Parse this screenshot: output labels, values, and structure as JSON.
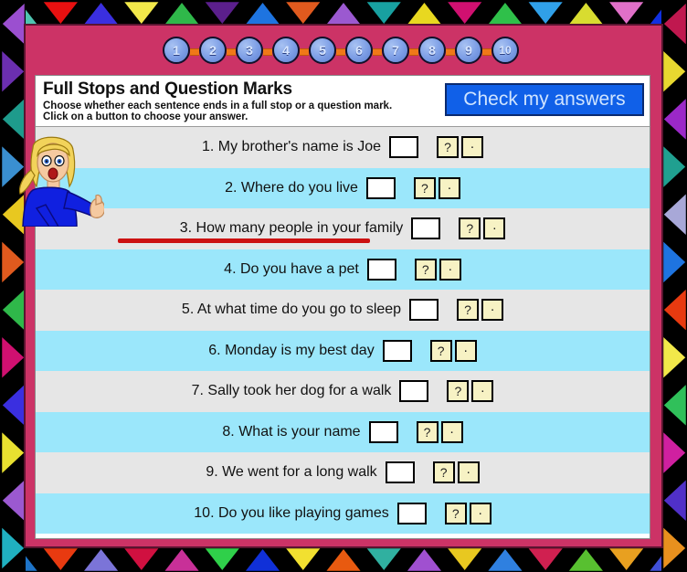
{
  "page": {
    "title": "Full Stops and Question Marks",
    "instruction_line1": "Choose whether each sentence ends in a full stop or a question mark.",
    "instruction_line2": "Click on a button to choose your answer.",
    "check_button_label": "Check my answers",
    "question_mark_label": "?",
    "full_stop_label": "."
  },
  "colors": {
    "frame_pink": "#CC3366",
    "check_button_blue": "#1060E8",
    "check_button_text": "#CFE4FF",
    "row_odd": "#E6E6E6",
    "row_even": "#9BE7FB",
    "answer_button_yellow": "#F7F2C4",
    "underline_red": "#CC1111",
    "node_blue": "#7E9FE6",
    "chain_orange": "#F07818"
  },
  "nav": {
    "nodes": [
      {
        "label": "1"
      },
      {
        "label": "2"
      },
      {
        "label": "3"
      },
      {
        "label": "4"
      },
      {
        "label": "5"
      },
      {
        "label": "6"
      },
      {
        "label": "7"
      },
      {
        "label": "8"
      },
      {
        "label": "9"
      },
      {
        "label": "10"
      }
    ]
  },
  "questions": [
    {
      "number": "1.",
      "text": "My brother's name is Joe",
      "value": "",
      "underlined": true
    },
    {
      "number": "2.",
      "text": "Where do you live",
      "value": "",
      "underlined": false
    },
    {
      "number": "3.",
      "text": "How many people in your family",
      "value": "",
      "underlined": false
    },
    {
      "number": "4.",
      "text": "Do you have a pet",
      "value": "",
      "underlined": false
    },
    {
      "number": "5.",
      "text": "At what time do you go to sleep",
      "value": "",
      "underlined": false
    },
    {
      "number": "6.",
      "text": "Monday is my best day",
      "value": "",
      "underlined": false
    },
    {
      "number": "7.",
      "text": "Sally took her dog for a walk",
      "value": "",
      "underlined": false
    },
    {
      "number": "8.",
      "text": "What is your name",
      "value": "",
      "underlined": false
    },
    {
      "number": "9.",
      "text": "We went for a long walk",
      "value": "",
      "underlined": false
    },
    {
      "number": "10.",
      "text": "Do you like playing games",
      "value": "",
      "underlined": false
    }
  ],
  "border": {
    "top_colors": [
      "#4FC3B0",
      "#E81010",
      "#3A2FE0",
      "#F2E84A",
      "#2FB84A",
      "#5B1F8C",
      "#1E74E0",
      "#E05A1E",
      "#9B59D0",
      "#18A0A0",
      "#E8D820",
      "#D01070",
      "#2FC04A",
      "#30A0E8",
      "#D8DC30",
      "#E070C8",
      "#1030E0"
    ],
    "bottom_colors": [
      "#1E74C8",
      "#E83A10",
      "#7B74D8",
      "#D01040",
      "#C83098",
      "#2FD04A",
      "#1030D8",
      "#F2E030",
      "#E85A10",
      "#30B0A0",
      "#A050D0",
      "#E8C820",
      "#2F80E0",
      "#D02050",
      "#58C030",
      "#E8A020",
      "#4050D8"
    ],
    "left_colors": [
      "#9B4FD0",
      "#6B2FB0",
      "#1E9B8C",
      "#3A8FD0",
      "#E8C820",
      "#E05A1E",
      "#2FB84A",
      "#D01070",
      "#3A2FE0",
      "#E8E030",
      "#9B59D0",
      "#20B0C0"
    ],
    "right_colors": [
      "#C0184F",
      "#E8D830",
      "#9B28C8",
      "#20A090",
      "#A8A8D8",
      "#1E74E0",
      "#E83A10",
      "#F2E84A",
      "#30C05A",
      "#D020A0",
      "#5030C8",
      "#E8901E"
    ]
  },
  "character": {
    "name": "cartoon-girl-pointing",
    "hair_color": "#F2D35A",
    "shirt_color": "#1020E0",
    "skin_color": "#F5C9A0"
  }
}
